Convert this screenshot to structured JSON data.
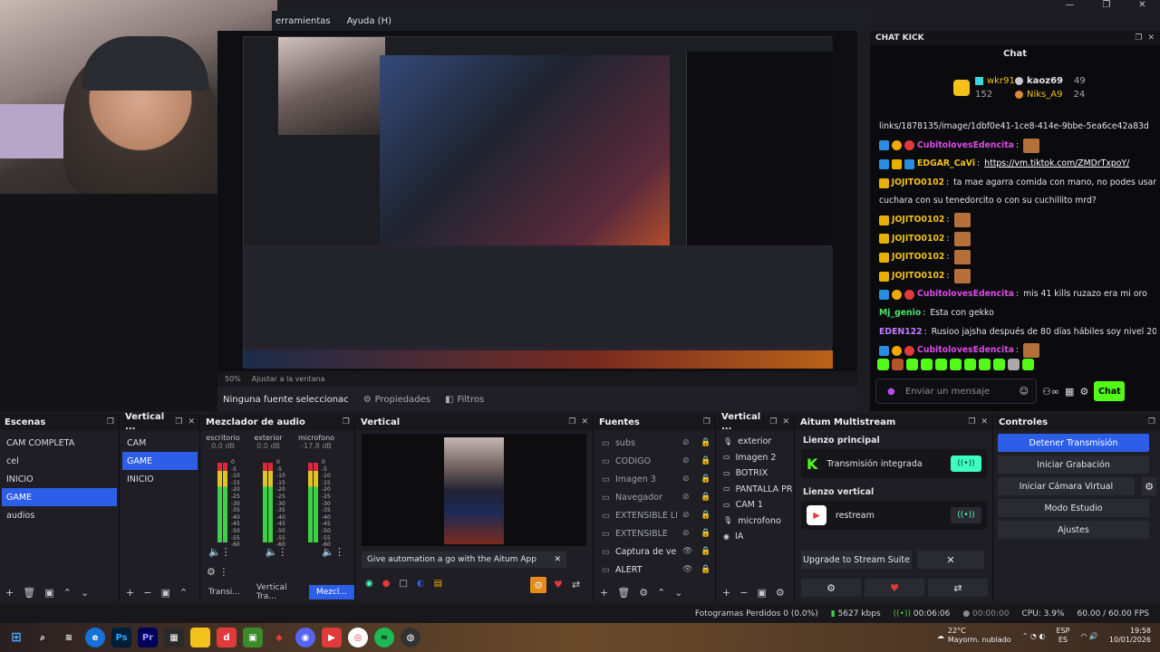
{
  "menu": [
    "erramientas",
    "Ayuda (H)"
  ],
  "window_controls": [
    "—",
    "❐",
    "✕"
  ],
  "preview": {
    "zoom": "50%",
    "fit": "Ajustar a la ventana",
    "no_source": "Ninguna fuente seleccionac",
    "properties": "Propiedades",
    "filters": "Filtros"
  },
  "chat": {
    "title": "CHAT KICK",
    "subtitle": "Chat",
    "top": [
      {
        "name": "wkr91",
        "count": "152"
      },
      {
        "name": "kaoz69",
        "count": "49"
      },
      {
        "name": "Niks_A9",
        "count": "24"
      }
    ],
    "messages": [
      {
        "user": "",
        "text": "links/1878135/image/1dbf0e41-1ce8-414e-9bbe-5ea6ce42a83d",
        "color": "#ffffff",
        "badges": []
      },
      {
        "user": "CubitolovesEdencita",
        "text": "",
        "color": "#d94de2",
        "badges": [
          "b1",
          "b2",
          "b3"
        ]
      },
      {
        "user": "EDGAR_CaVi",
        "text": "https://vm.tiktok.com/ZMDrTxpoY/",
        "color": "#f2c21b",
        "badges": [
          "b1",
          "b4",
          "b1"
        ],
        "link": true
      },
      {
        "user": "JOJITO0102",
        "text": "ta mae agarra comida con mano, no podes usar",
        "color": "#f2c21b",
        "badges": [
          "b4"
        ]
      },
      {
        "user": "",
        "text": "cuchara con su tenedorcito o con su cuchillito mrd?",
        "color": "#ffffff",
        "badges": []
      },
      {
        "user": "JOJITO0102",
        "text": "",
        "color": "#f2c21b",
        "badges": [
          "b4"
        ]
      },
      {
        "user": "JOJITO0102",
        "text": "",
        "color": "#f2c21b",
        "badges": [
          "b4"
        ]
      },
      {
        "user": "JOJITO0102",
        "text": "",
        "color": "#f2c21b",
        "badges": [
          "b4"
        ]
      },
      {
        "user": "JOJITO0102",
        "text": "",
        "color": "#f2c21b",
        "badges": [
          "b4"
        ]
      },
      {
        "user": "CubitolovesEdencita",
        "text": "mis 41 kills ruzazo era mi oro",
        "color": "#d94de2",
        "badges": [
          "b1",
          "b2",
          "b3"
        ]
      },
      {
        "user": "Mj_genio",
        "text": "Esta con gekko",
        "color": "#4ce26a",
        "badges": []
      },
      {
        "user": "EDEN122",
        "text": "Rusioo jajsha después de 80 días hábiles soy nivel 20",
        "color": "#c17bff",
        "badges": []
      },
      {
        "user": "CubitolovesEdencita",
        "text": "",
        "color": "#d94de2",
        "badges": [
          "b1",
          "b2",
          "b3"
        ]
      }
    ],
    "input_placeholder": "Enviar un mensaje",
    "send_label": "Chat"
  },
  "docks": {
    "scenes": {
      "title": "Escenas",
      "items": [
        "CAM COMPLETA",
        "cel",
        "INICIO",
        "GAME",
        "audios"
      ],
      "selected": 3
    },
    "vertical_scenes": {
      "title": "Vertical ...",
      "items": [
        "CAM",
        "GAME",
        "INICIO"
      ],
      "selected": 1
    },
    "mixer": {
      "title": "Mezclador de audio",
      "channels": [
        {
          "name": "escritorio",
          "db": "0.0 dB"
        },
        {
          "name": "exterior",
          "db": "0.0 dB"
        },
        {
          "name": "microfono",
          "db": "-17.8 dB"
        }
      ],
      "scale": [
        "0",
        "-5",
        "-10",
        "-15",
        "-20",
        "-25",
        "-30",
        "-35",
        "-40",
        "-45",
        "-50",
        "-55",
        "-60"
      ],
      "tabs": [
        "Transi...",
        "Vertical Tra...",
        "Mezcl..."
      ]
    },
    "vertical_preview": {
      "title": "Vertical",
      "banner": "Give automation a go with the Aitum App"
    },
    "sources": {
      "title": "Fuentes",
      "items": [
        "subs",
        "CODIGO",
        "Imagen 3",
        "Navegador",
        "EXTENSIBLE LE",
        "EXTENSIBLE",
        "Captura de ven",
        "ALERT"
      ]
    },
    "vertical_sources": {
      "title": "Vertical ...",
      "items": [
        "exterior",
        "Imagen 2",
        "BOTRIX",
        "PANTALLA PRIN",
        "CAM 1",
        "microfono",
        "IA"
      ]
    },
    "aitum": {
      "title": "Aitum Multistream",
      "main_label": "Lienzo principal",
      "main_item": "Transmisión integrada",
      "vertical_label": "Lienzo vertical",
      "vertical_item": "restream",
      "upgrade": "Upgrade to Stream Suite"
    },
    "controls": {
      "title": "Controles",
      "buttons": [
        "Detener Transmisión",
        "Iniciar Grabación",
        "Iniciar Cámara Virtual",
        "Modo Estudio",
        "Ajustes"
      ]
    }
  },
  "status": {
    "dropped": "Fotogramas Perdidos 0 (0.0%)",
    "bitrate": "5627 kbps",
    "stream_time": "00:06:06",
    "rec_time": "00:00:00",
    "cpu": "CPU: 3.9%",
    "fps": "60.00 / 60.00 FPS"
  },
  "taskbar": {
    "weather_temp": "22°C",
    "weather_desc": "Mayorm. nublado",
    "lang": "ESP",
    "lang2": "ES",
    "time": "19:58",
    "date": "10/01/2026"
  },
  "colors": {
    "accent": "#2d5ee8",
    "kick_green": "#53fc18",
    "aitum_teal": "#3dffc2"
  }
}
